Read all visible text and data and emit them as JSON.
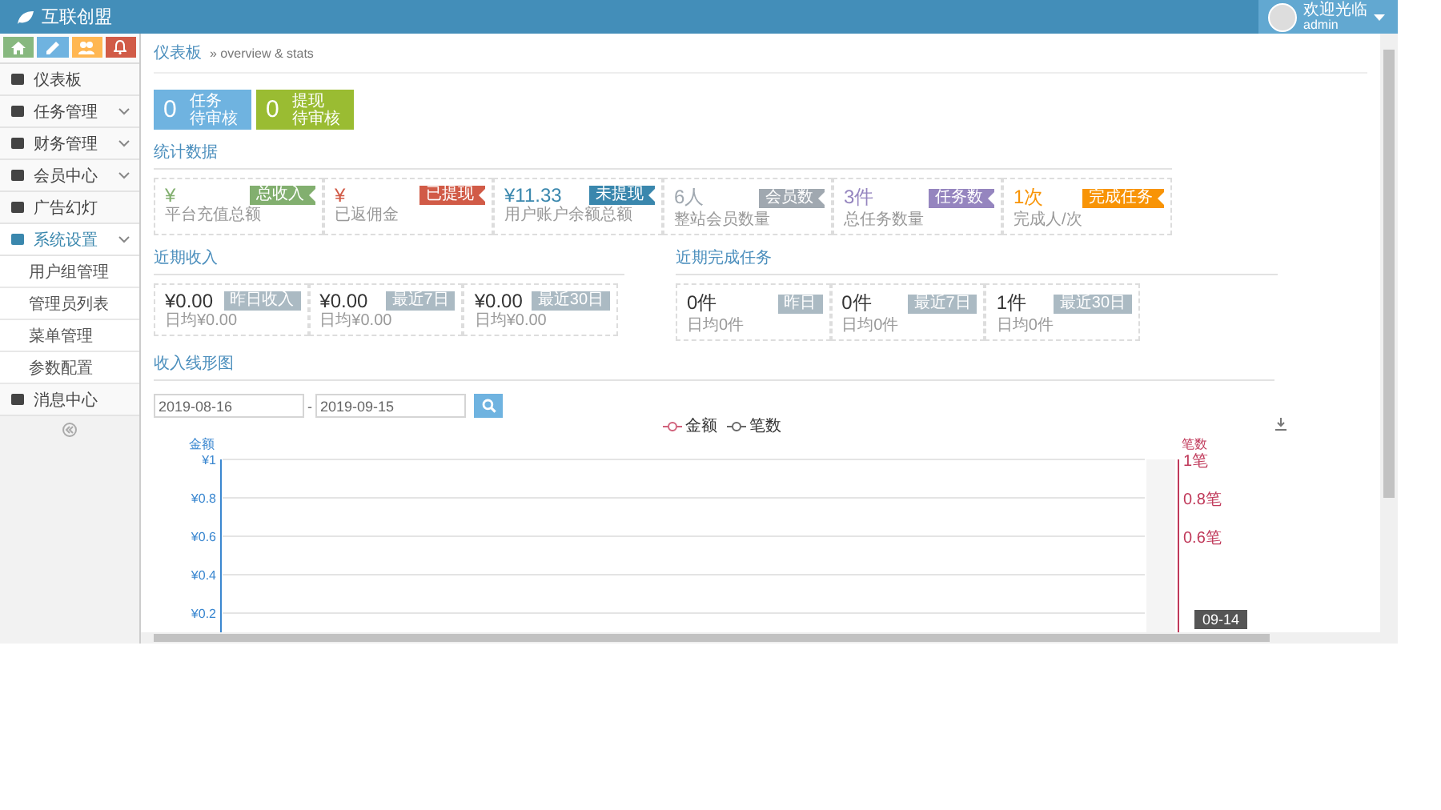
{
  "header": {
    "brand": "互联创盟",
    "user": {
      "greeting": "欢迎光临",
      "name": "admin"
    }
  },
  "shortcuts": [
    {
      "color": "#87b87f"
    },
    {
      "color": "#6fb3e0"
    },
    {
      "color": "#ffb752"
    },
    {
      "color": "#d15b47"
    }
  ],
  "sidebar": {
    "items": [
      {
        "label": "仪表板",
        "expandable": false,
        "selected": false
      },
      {
        "label": "任务管理",
        "expandable": true,
        "selected": false
      },
      {
        "label": "财务管理",
        "expandable": true,
        "selected": false
      },
      {
        "label": "会员中心",
        "expandable": true,
        "selected": false
      },
      {
        "label": "广告幻灯",
        "expandable": false,
        "selected": false
      },
      {
        "label": "系统设置",
        "expandable": true,
        "selected": true,
        "children": [
          {
            "label": "用户组管理"
          },
          {
            "label": "管理员列表"
          },
          {
            "label": "菜单管理"
          },
          {
            "label": "参数配置"
          }
        ]
      },
      {
        "label": "消息中心",
        "expandable": false,
        "selected": false
      }
    ]
  },
  "breadcrumb": {
    "link": "仪表板",
    "text": "» overview & stats"
  },
  "pending": [
    {
      "count": "0",
      "title": "任务",
      "subtitle": "待审核",
      "color": "#6fb3e0"
    },
    {
      "count": "0",
      "title": "提现",
      "subtitle": "待审核",
      "color": "#9abc32"
    }
  ],
  "stats": {
    "title": "统计数据",
    "cards": [
      {
        "value": "¥",
        "tag": "总收入",
        "caption": "平台充值总额",
        "color": "#82af6f"
      },
      {
        "value": "¥",
        "tag": "已提现",
        "caption": "已返佣金",
        "color": "#d15b47"
      },
      {
        "value": "¥11.33",
        "tag": "未提现",
        "caption": "用户账户余额总额",
        "color": "#3a87ad"
      },
      {
        "value": "6人",
        "tag": "会员数",
        "caption": "整站会员数量",
        "color": "#a0a8b0"
      },
      {
        "value": "3件",
        "tag": "任务数",
        "caption": "总任务数量",
        "color": "#9585bf"
      },
      {
        "value": "1次",
        "tag": "完成任务",
        "caption": "完成人/次",
        "color": "#f89406"
      }
    ]
  },
  "income": {
    "title": "近期收入",
    "cards": [
      {
        "value": "¥0.00",
        "tag": "昨日收入",
        "caption": "日均¥0.00"
      },
      {
        "value": "¥0.00",
        "tag": "最近7日",
        "caption": "日均¥0.00"
      },
      {
        "value": "¥0.00",
        "tag": "最近30日",
        "caption": "日均¥0.00"
      }
    ]
  },
  "tasks": {
    "title": "近期完成任务",
    "cards": [
      {
        "value": "0件",
        "tag": "昨日",
        "caption": "日均0件"
      },
      {
        "value": "0件",
        "tag": "最近7日",
        "caption": "日均0件"
      },
      {
        "value": "1件",
        "tag": "最近30日",
        "caption": "日均0件"
      }
    ]
  },
  "chart": {
    "title": "收入线形图",
    "start_date": "2019-08-16",
    "separator": "-",
    "end_date": "2019-09-15",
    "legend": [
      {
        "label": "金额",
        "color": "#d0607a"
      },
      {
        "label": "笔数",
        "color": "#666666"
      }
    ],
    "left_axis": {
      "name": "金额",
      "ticks": [
        "¥1",
        "¥0.8",
        "¥0.6",
        "¥0.4",
        "¥0.2"
      ]
    },
    "right_axis": {
      "name": "笔数",
      "ticks": [
        "1笔",
        "0.8笔",
        "0.6笔"
      ]
    },
    "tooltip": "09-14"
  }
}
